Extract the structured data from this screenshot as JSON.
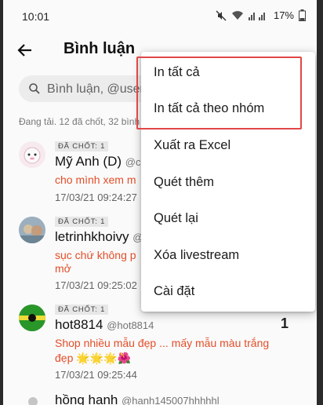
{
  "status_bar": {
    "time": "10:01",
    "battery": "17%"
  },
  "header": {
    "title": "Bình luận"
  },
  "search": {
    "placeholder": "Bình luận, @username"
  },
  "loading_text": "Đang tải. 12 đã chốt, 32 bình luận",
  "comments": [
    {
      "badge": "ĐÃ CHỐT: 1",
      "name": "Mỹ Anh (D)",
      "handle": "@cl",
      "text": "cho mình xem m",
      "time": "17/03/21 09:24:27"
    },
    {
      "badge": "ĐÃ CHỐT: 1",
      "name": "letrinhkhoivy",
      "handle": "@",
      "text": "sục chứ không p",
      "text2": "mở",
      "time": "17/03/21 09:25:02"
    },
    {
      "badge": "ĐÃ CHỐT: 1",
      "name": "hot8814",
      "handle": "@hot8814",
      "text": "Shop nhiều mẫu đẹp  ... mấy mẫu màu trắng đẹp 🌟🌟🌟🌺",
      "time": "17/03/21 09:25:44",
      "count": "1"
    },
    {
      "name": "hồng hạnh",
      "handle": "@hanh145007hhhhhl"
    }
  ],
  "menu": {
    "items": [
      "In tất cả",
      "In tất cả theo nhóm",
      "Xuất ra Excel",
      "Quét thêm",
      "Quét lại",
      "Xóa livestream",
      "Cài đặt"
    ]
  },
  "colors": {
    "accent_text": "#e8502a",
    "highlight_border": "#e04848"
  }
}
